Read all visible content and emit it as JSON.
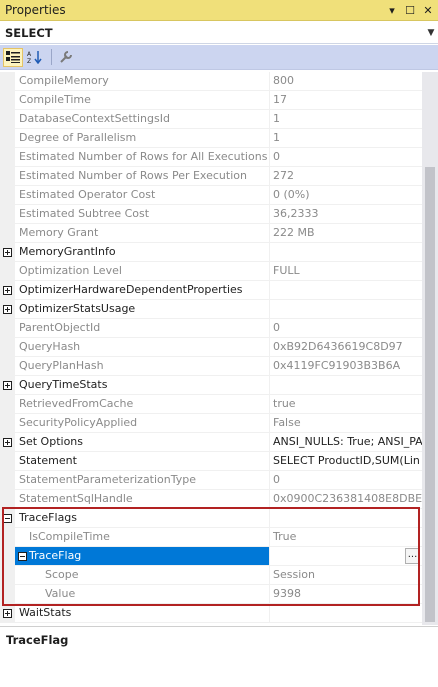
{
  "window": {
    "title": "Properties"
  },
  "object_selector": {
    "value": "SELECT"
  },
  "toolbar": {
    "icons": [
      "categorized-icon",
      "alphabetical-icon",
      "property-pages-icon"
    ]
  },
  "rows": [
    {
      "name": "CompileMemory",
      "value": "800",
      "editable": false
    },
    {
      "name": "CompileTime",
      "value": "17",
      "editable": false
    },
    {
      "name": "DatabaseContextSettingsId",
      "value": "1",
      "editable": false
    },
    {
      "name": "Degree of Parallelism",
      "value": "1",
      "editable": false
    },
    {
      "name": "Estimated Number of Rows for All Executions",
      "value": "0",
      "editable": false
    },
    {
      "name": "Estimated Number of Rows Per Execution",
      "value": "272",
      "editable": false
    },
    {
      "name": "Estimated Operator Cost",
      "value": "0 (0%)",
      "editable": false
    },
    {
      "name": "Estimated Subtree Cost",
      "value": "36,2333",
      "editable": false
    },
    {
      "name": "Memory Grant",
      "value": "222 MB",
      "editable": false
    },
    {
      "name": "MemoryGrantInfo",
      "value": "",
      "editable": true,
      "expander": "plus"
    },
    {
      "name": "Optimization Level",
      "value": "FULL",
      "editable": false
    },
    {
      "name": "OptimizerHardwareDependentProperties",
      "value": "",
      "editable": true,
      "expander": "plus"
    },
    {
      "name": "OptimizerStatsUsage",
      "value": "",
      "editable": true,
      "expander": "plus"
    },
    {
      "name": "ParentObjectId",
      "value": "0",
      "editable": false
    },
    {
      "name": "QueryHash",
      "value": "0xB92D6436619C8D97",
      "editable": false
    },
    {
      "name": "QueryPlanHash",
      "value": "0x4119FC91903B3B6A",
      "editable": false
    },
    {
      "name": "QueryTimeStats",
      "value": "",
      "editable": true,
      "expander": "plus"
    },
    {
      "name": "RetrievedFromCache",
      "value": "true",
      "editable": false
    },
    {
      "name": "SecurityPolicyApplied",
      "value": "False",
      "editable": false
    },
    {
      "name": "Set Options",
      "value": "ANSI_NULLS: True; ANSI_PA",
      "editable": true,
      "expander": "plus"
    },
    {
      "name": "Statement",
      "value": "SELECT  ProductID,SUM(Lin",
      "editable": true
    },
    {
      "name": "StatementParameterizationType",
      "value": "0",
      "editable": false
    },
    {
      "name": "StatementSqlHandle",
      "value": "0x0900C236381408E8DBEC3",
      "editable": false
    },
    {
      "name": "TraceFlags",
      "value": "",
      "editable": true,
      "expander": "minus"
    },
    {
      "name": "IsCompileTime",
      "value": "True",
      "editable": false,
      "indent": 1
    },
    {
      "name": "TraceFlag",
      "value": "",
      "editable": true,
      "indent": 1,
      "expander": "minus",
      "selected": true,
      "ellipsis": "..."
    },
    {
      "name": "Scope",
      "value": "Session",
      "editable": false,
      "indent": 2
    },
    {
      "name": "Value",
      "value": "9398",
      "editable": false,
      "indent": 2
    },
    {
      "name": "WaitStats",
      "value": "",
      "editable": true,
      "expander": "plus"
    }
  ],
  "description": {
    "title": "TraceFlag"
  }
}
